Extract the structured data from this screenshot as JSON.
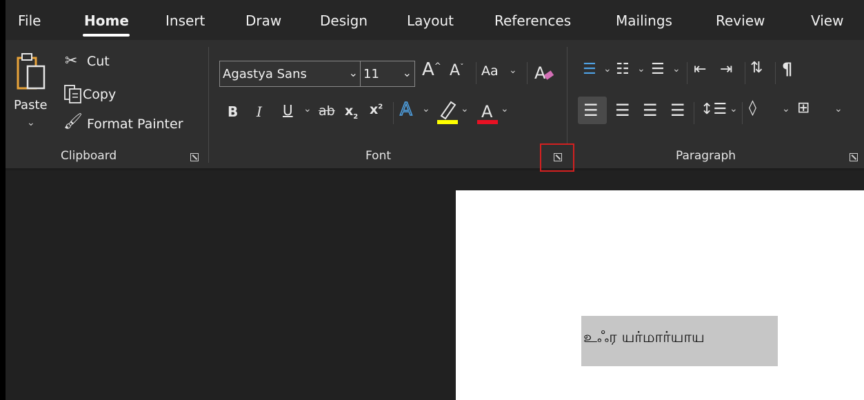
{
  "tabs": [
    "File",
    "Home",
    "Insert",
    "Draw",
    "Design",
    "Layout",
    "References",
    "Mailings",
    "Review",
    "View"
  ],
  "clipboard": {
    "paste": "Paste",
    "cut": "Cut",
    "copy": "Copy",
    "format_painter": "Format Painter",
    "group_label": "Clipboard"
  },
  "font": {
    "font_name": "Agastya Sans",
    "font_size": "11",
    "change_case": "Aa",
    "group_label": "Font",
    "highlight_color": "#ffff00",
    "font_color": "#e81123"
  },
  "paragraph": {
    "group_label": "Paragraph"
  },
  "document": {
    "selected_text": "உஃர யர்மார்யாய"
  },
  "colors": {
    "ribbon_bg": "#2f2f2f",
    "tab_bg": "#262626",
    "accent_highlight_box": "#d42020"
  }
}
